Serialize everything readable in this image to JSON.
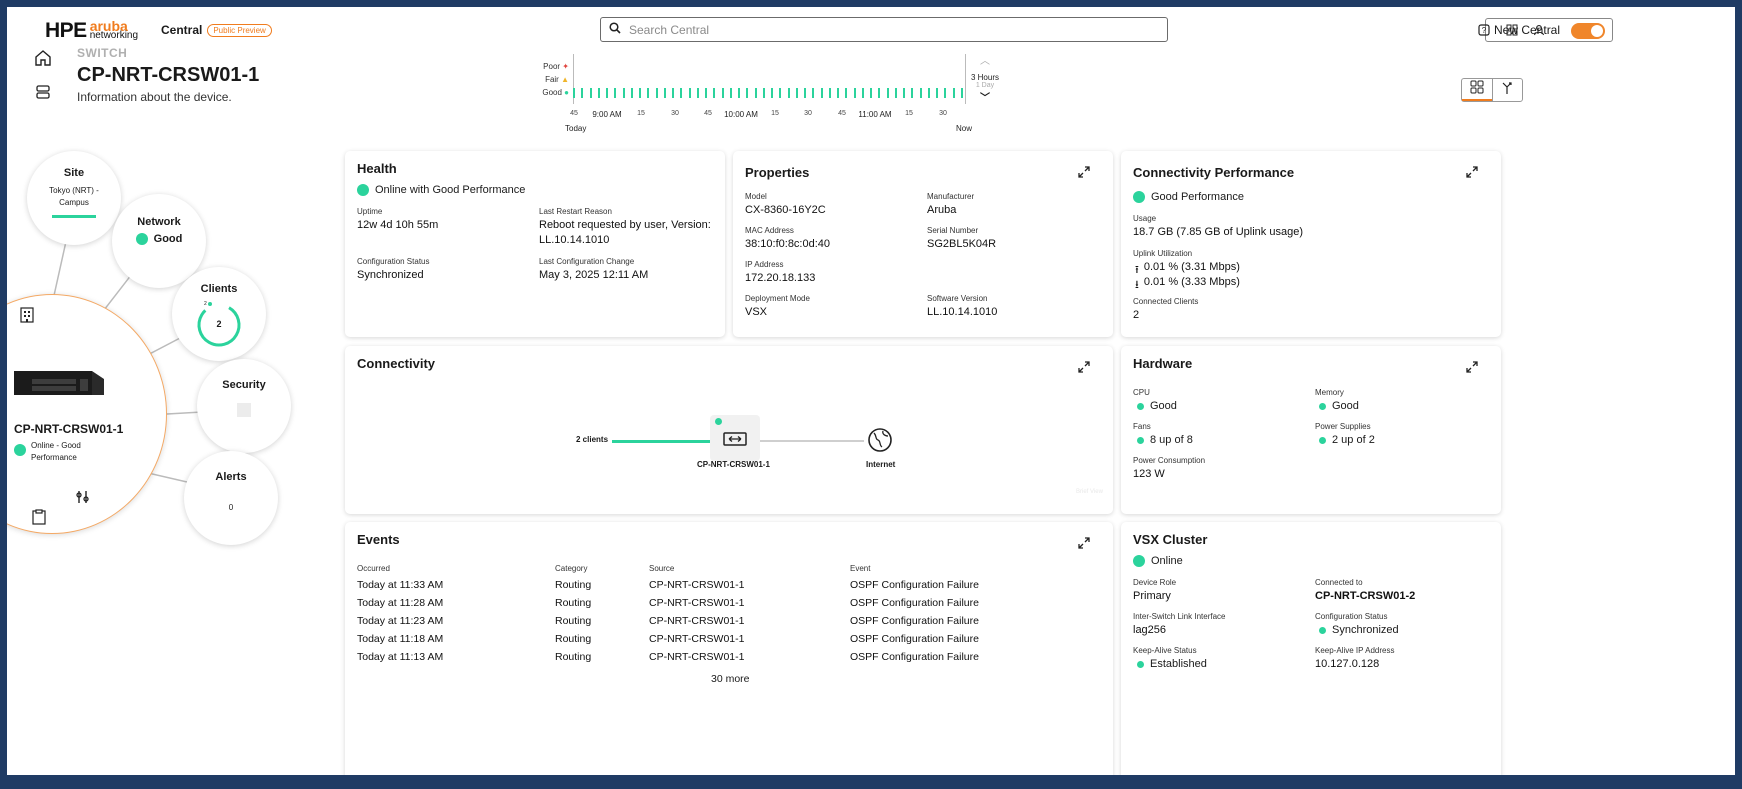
{
  "header": {
    "logo_hpe": "HPE",
    "logo_aruba": "aruba",
    "logo_networking": "networking",
    "app_name": "Central",
    "preview_badge": "Public Preview",
    "search_placeholder": "Search Central",
    "new_central_label": "New Central",
    "new_central_on": true
  },
  "page": {
    "crumb": "SWITCH",
    "title": "CP-NRT-CRSW01-1",
    "subtitle": "Information about the device."
  },
  "timeline": {
    "legend": [
      "Poor",
      "Fair",
      "Good"
    ],
    "ticks": [
      "45",
      "15",
      "30",
      "45",
      "15",
      "30",
      "45",
      "15",
      "30"
    ],
    "hours": [
      "9:00 AM",
      "10:00 AM",
      "11:00 AM"
    ],
    "start_label": "Today",
    "end_label": "Now",
    "range_selected": "3 Hours",
    "range_next": "1 Day",
    "status_color": "#2bd39c"
  },
  "radial": {
    "site_label": "Site",
    "site_value": "Tokyo (NRT) - Campus",
    "network_label": "Network",
    "network_value": "Good",
    "clients_label": "Clients",
    "clients_count": "2",
    "clients_mini": "2",
    "security_label": "Security",
    "alerts_label": "Alerts",
    "alerts_count": "0",
    "device_name": "CP-NRT-CRSW01-1",
    "device_status": "Online - Good Performance"
  },
  "health": {
    "title": "Health",
    "status": "Online with Good Performance",
    "uptime_label": "Uptime",
    "uptime_value": "12w 4d 10h 55m",
    "restart_label": "Last Restart Reason",
    "restart_value_1": "Reboot requested by user, Version:",
    "restart_value_2": "LL.10.14.1010",
    "config_status_label": "Configuration Status",
    "config_status_value": "Synchronized",
    "config_change_label": "Last Configuration Change",
    "config_change_value": "May 3, 2025 12:11 AM"
  },
  "properties": {
    "title": "Properties",
    "model_label": "Model",
    "model_value": "CX-8360-16Y2C",
    "manufacturer_label": "Manufacturer",
    "manufacturer_value": "Aruba",
    "mac_label": "MAC Address",
    "mac_value": "38:10:f0:8c:0d:40",
    "serial_label": "Serial Number",
    "serial_value": "SG2BL5K04R",
    "ip_label": "IP Address",
    "ip_value": "172.20.18.133",
    "deploy_label": "Deployment Mode",
    "deploy_value": "VSX",
    "sw_label": "Software Version",
    "sw_value": "LL.10.14.1010"
  },
  "connperf": {
    "title": "Connectivity Performance",
    "status": "Good Performance",
    "usage_label": "Usage",
    "usage_value": "18.7 GB (7.85 GB of Uplink usage)",
    "uplink_label": "Uplink Utilization",
    "uplink_up": "0.01 % (3.31 Mbps)",
    "uplink_down": "0.01 % (3.33 Mbps)",
    "clients_label": "Connected Clients",
    "clients_value": "2"
  },
  "connectivity": {
    "title": "Connectivity",
    "clients": "2 clients",
    "device": "CP-NRT-CRSW01-1",
    "internet": "Internet",
    "faint": "Brief View"
  },
  "hardware": {
    "title": "Hardware",
    "cpu_label": "CPU",
    "cpu_value": "Good",
    "memory_label": "Memory",
    "memory_value": "Good",
    "fans_label": "Fans",
    "fans_value": "8 up of 8",
    "psu_label": "Power Supplies",
    "psu_value": "2 up of 2",
    "power_label": "Power Consumption",
    "power_value": "123 W"
  },
  "events": {
    "title": "Events",
    "columns": [
      "Occurred",
      "Category",
      "Source",
      "Event"
    ],
    "rows": [
      [
        "Today at 11:33 AM",
        "Routing",
        "CP-NRT-CRSW01-1",
        "OSPF Configuration Failure"
      ],
      [
        "Today at 11:28 AM",
        "Routing",
        "CP-NRT-CRSW01-1",
        "OSPF Configuration Failure"
      ],
      [
        "Today at 11:23 AM",
        "Routing",
        "CP-NRT-CRSW01-1",
        "OSPF Configuration Failure"
      ],
      [
        "Today at 11:18 AM",
        "Routing",
        "CP-NRT-CRSW01-1",
        "OSPF Configuration Failure"
      ],
      [
        "Today at 11:13 AM",
        "Routing",
        "CP-NRT-CRSW01-1",
        "OSPF Configuration Failure"
      ]
    ],
    "more": "30 more"
  },
  "vsx": {
    "title": "VSX Cluster",
    "status": "Online",
    "role_label": "Device Role",
    "role_value": "Primary",
    "connected_label": "Connected to",
    "connected_value": "CP-NRT-CRSW01-2",
    "isl_label": "Inter-Switch Link Interface",
    "isl_value": "lag256",
    "config_label": "Configuration Status",
    "config_value": "Synchronized",
    "ka_label": "Keep-Alive Status",
    "ka_value": "Established",
    "kaip_label": "Keep-Alive IP Address",
    "kaip_value": "10.127.0.128"
  },
  "colors": {
    "accent": "#f07c1e",
    "good": "#2bd39c",
    "frame": "#1f3b64"
  }
}
